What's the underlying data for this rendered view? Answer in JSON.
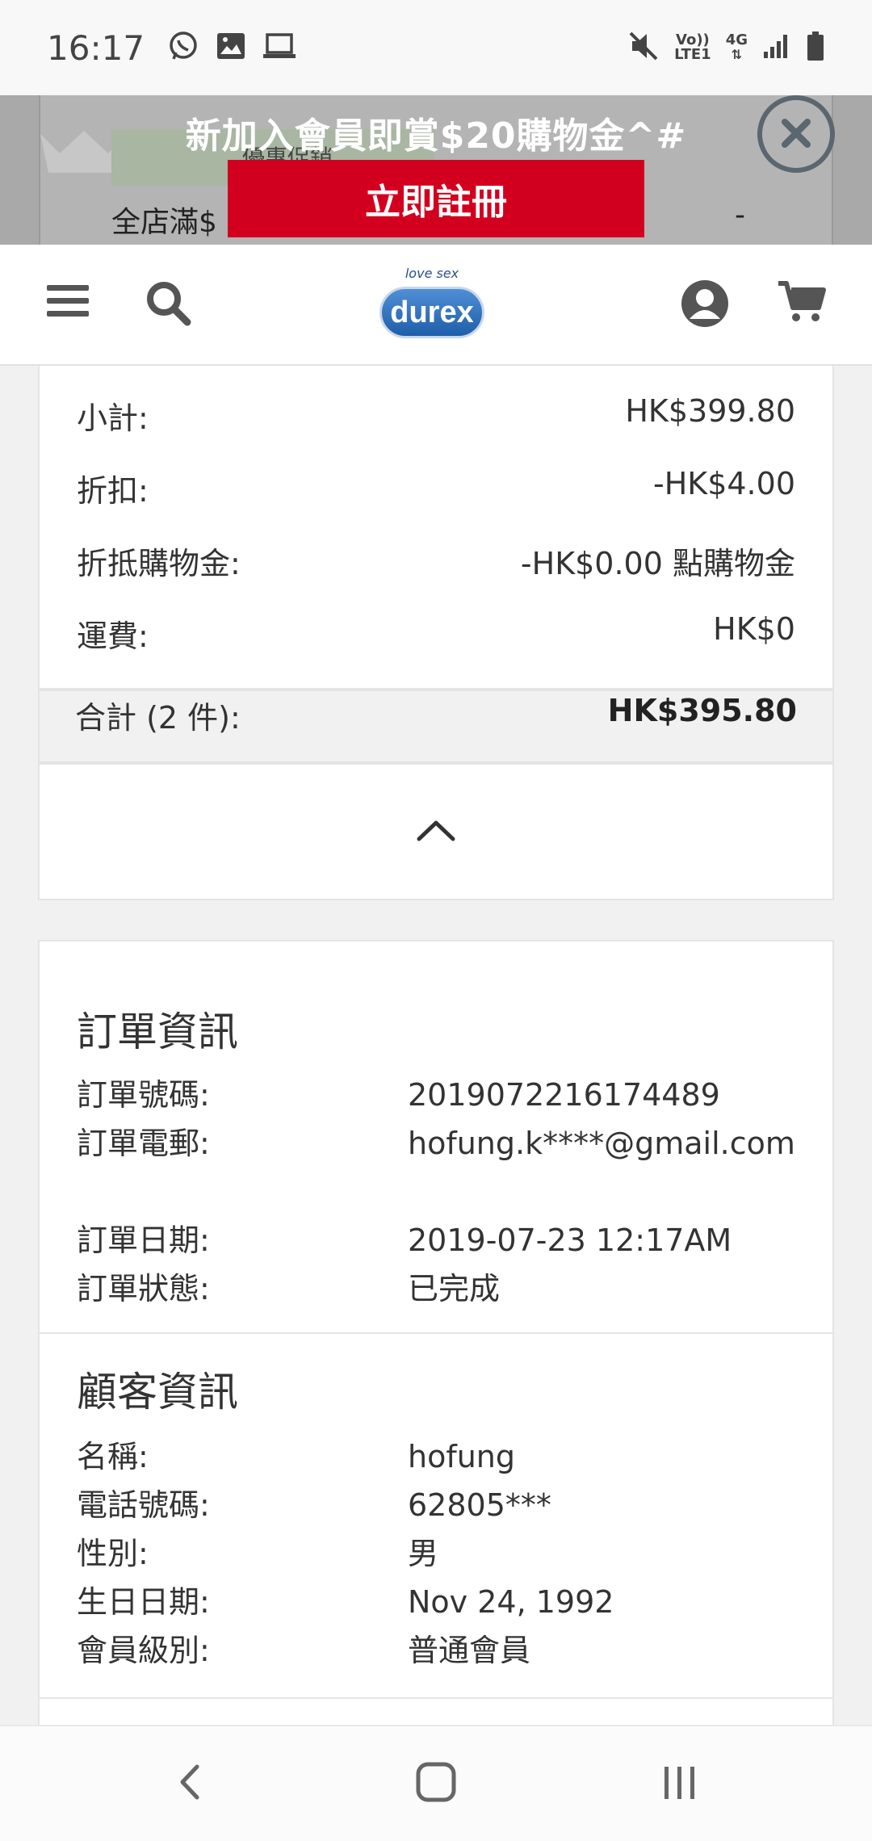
{
  "status_bar": {
    "time": "16:17",
    "left_icons": [
      "whatsapp-icon",
      "image-icon",
      "laptop-icon"
    ],
    "volte_label_top": "Vo))",
    "volte_label_bottom": "LTE1",
    "network_label": "4G",
    "right_icons": [
      "mute-icon",
      "signal-icon",
      "battery-icon"
    ]
  },
  "promo": {
    "title": "新加入會員即賞$20購物金^#",
    "register_label": "立即註冊",
    "underlay_label": "優惠促銷",
    "underlay_text": "全店滿$",
    "underlay_dash": "-"
  },
  "header": {
    "logo_tagline": "love sex",
    "logo_brand": "durex",
    "icons": [
      "menu-icon",
      "search-icon",
      "account-icon",
      "cart-icon"
    ]
  },
  "totals": {
    "rows": [
      {
        "label": "小計:",
        "value": "HK$399.80"
      },
      {
        "label": "折扣:",
        "value": "-HK$4.00"
      },
      {
        "label": "折抵購物金:",
        "value": "-HK$0.00 點購物金"
      },
      {
        "label": "運費:",
        "value": "HK$0"
      },
      {
        "label": "合計 (2 件):",
        "value": "HK$395.80"
      }
    ]
  },
  "order_info": {
    "title": "訂單資訊",
    "rows": [
      {
        "label": "訂單號碼:",
        "value": "2019072216174489"
      },
      {
        "label": "訂單電郵:",
        "value": "hofung.k****@gmail.com"
      },
      {
        "label": "訂單日期:",
        "value": "2019-07-23 12:17AM"
      },
      {
        "label": "訂單狀態:",
        "value": "已完成"
      }
    ]
  },
  "customer_info": {
    "title": "顧客資訊",
    "rows": [
      {
        "label": "名稱:",
        "value": "hofung"
      },
      {
        "label": "電話號碼:",
        "value": "62805***"
      },
      {
        "label": "性別:",
        "value": "男"
      },
      {
        "label": "生日日期:",
        "value": "Nov 24, 1992"
      },
      {
        "label": "會員級別:",
        "value": "普通會員"
      }
    ]
  },
  "colors": {
    "accent_red": "#d2001e",
    "logo_blue": "#1f5ea8",
    "icon_gray": "#555555"
  }
}
